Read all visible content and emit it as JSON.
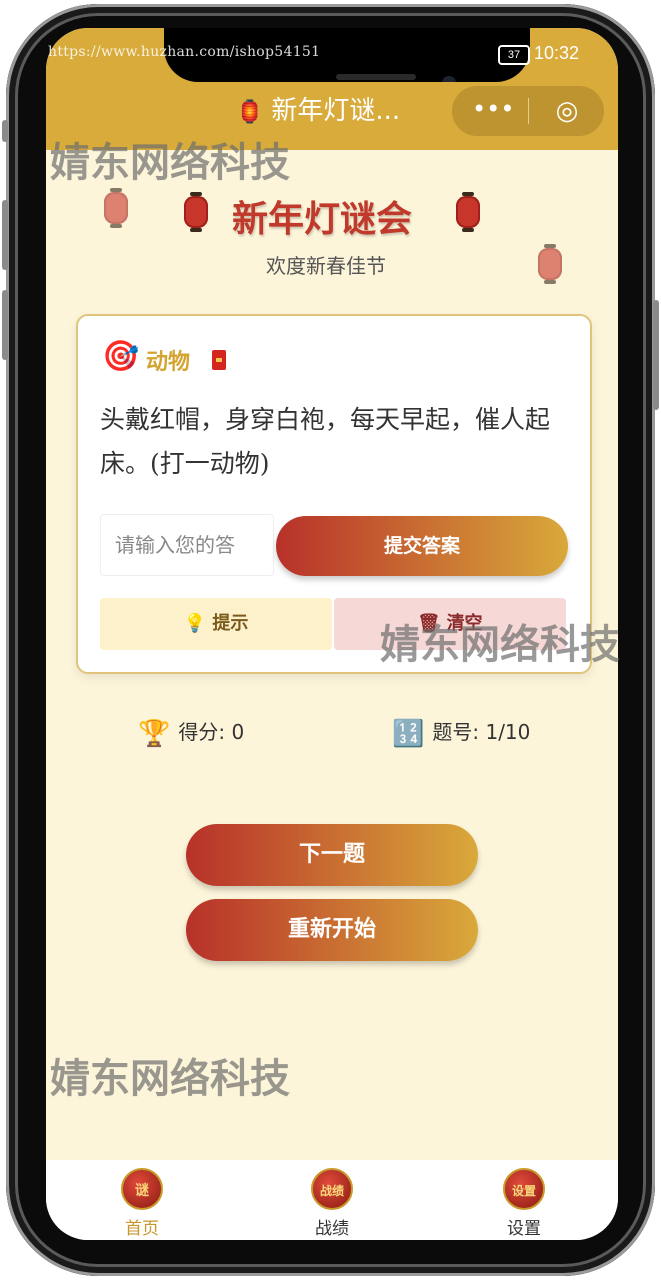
{
  "status_bar": {
    "battery": "37",
    "time": "10:32"
  },
  "watermark_url": "https://www.huzhan.com/ishop54151",
  "nav": {
    "title": "新年灯谜...",
    "lamp_icon": "🏮",
    "more_icon": "•••",
    "close_icon": "◎"
  },
  "hero": {
    "title": "新年灯谜会",
    "subtitle": "欢度新春佳节"
  },
  "card": {
    "category_icon": "🎯",
    "category": "动物",
    "riddle": "头戴红帽，身穿白袍，每天早起，催人起床。(打一动物)",
    "answer_placeholder": "请输入您的答",
    "submit_label": "提交答案",
    "hint_icon": "💡",
    "hint_label": "提示",
    "clear_icon": "🗑",
    "clear_label": "清空"
  },
  "stats": {
    "score_icon": "🏆",
    "score": "得分: 0",
    "question_icon": "🔢",
    "question": "题号: 1/10"
  },
  "actions": {
    "next_label": "下一题",
    "restart_label": "重新开始"
  },
  "watermark_text": "婧东网络科技",
  "tabs": [
    {
      "label": "首页",
      "icon_text": "谜",
      "active": true
    },
    {
      "label": "战绩",
      "icon_text": "战绩",
      "active": false
    },
    {
      "label": "设置",
      "icon_text": "设置",
      "active": false
    }
  ],
  "colors": {
    "accent": "#d8ab3a",
    "red": "#c0392b",
    "background": "#fdf5da"
  }
}
